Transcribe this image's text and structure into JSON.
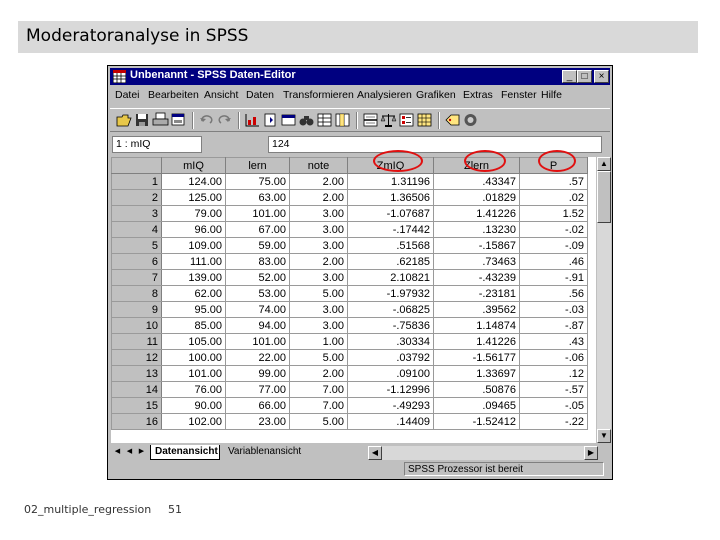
{
  "slide": {
    "title": "Moderatoranalyse in SPSS",
    "footer": "02_multiple_regression",
    "page_number": "51"
  },
  "window": {
    "title": "Unbenannt - SPSS Daten-Editor",
    "buttons": {
      "minimize": "_",
      "maximize": "□",
      "close": "×"
    }
  },
  "menu": [
    "Datei",
    "Bearbeiten",
    "Ansicht",
    "Daten",
    "Transformieren",
    "Analysieren",
    "Grafiken",
    "Extras",
    "Fenster",
    "Hilfe"
  ],
  "toolbar": {
    "icons": [
      "open-icon",
      "save-icon",
      "print-icon",
      "dialog-recall-icon",
      "undo-icon",
      "redo-icon",
      "goto-chart-icon",
      "goto-case-icon",
      "variables-icon",
      "find-icon",
      "insert-case-icon",
      "insert-variable-icon",
      "split-file-icon",
      "weight-cases-icon",
      "select-cases-icon",
      "value-labels-icon",
      "use-sets-icon"
    ]
  },
  "cell_editor": {
    "reference": "1 : mIQ",
    "value": "124"
  },
  "grid": {
    "columns": [
      "mIQ",
      "lern",
      "note",
      "ZmIQ",
      "Zlern",
      "P"
    ],
    "rows": [
      {
        "n": "1",
        "cells": [
          "124.00",
          "75.00",
          "2.00",
          "1.31196",
          ".43347",
          ".57"
        ]
      },
      {
        "n": "2",
        "cells": [
          "125.00",
          "63.00",
          "2.00",
          "1.36506",
          ".01829",
          ".02"
        ]
      },
      {
        "n": "3",
        "cells": [
          "79.00",
          "101.00",
          "3.00",
          "-1.07687",
          "1.41226",
          "1.52"
        ]
      },
      {
        "n": "4",
        "cells": [
          "96.00",
          "67.00",
          "3.00",
          "-.17442",
          ".13230",
          "-.02"
        ]
      },
      {
        "n": "5",
        "cells": [
          "109.00",
          "59.00",
          "3.00",
          ".51568",
          "-.15867",
          "-.09"
        ]
      },
      {
        "n": "6",
        "cells": [
          "111.00",
          "83.00",
          "2.00",
          ".62185",
          ".73463",
          ".46"
        ]
      },
      {
        "n": "7",
        "cells": [
          "139.00",
          "52.00",
          "3.00",
          "2.10821",
          "-.43239",
          "-.91"
        ]
      },
      {
        "n": "8",
        "cells": [
          "62.00",
          "53.00",
          "5.00",
          "-1.97932",
          "-.23181",
          ".56"
        ]
      },
      {
        "n": "9",
        "cells": [
          "95.00",
          "74.00",
          "3.00",
          "-.06825",
          ".39562",
          "-.03"
        ]
      },
      {
        "n": "10",
        "cells": [
          "85.00",
          "94.00",
          "3.00",
          "-.75836",
          "1.14874",
          "-.87"
        ]
      },
      {
        "n": "11",
        "cells": [
          "105.00",
          "101.00",
          "1.00",
          ".30334",
          "1.41226",
          ".43"
        ]
      },
      {
        "n": "12",
        "cells": [
          "100.00",
          "22.00",
          "5.00",
          ".03792",
          "-1.56177",
          "-.06"
        ]
      },
      {
        "n": "13",
        "cells": [
          "101.00",
          "99.00",
          "2.00",
          ".09100",
          "1.33697",
          ".12"
        ]
      },
      {
        "n": "14",
        "cells": [
          "76.00",
          "77.00",
          "7.00",
          "-1.12996",
          ".50876",
          "-.57"
        ]
      },
      {
        "n": "15",
        "cells": [
          "90.00",
          "66.00",
          "7.00",
          "-.49293",
          ".09465",
          "-.05"
        ]
      },
      {
        "n": "16",
        "cells": [
          "102.00",
          "23.00",
          "5.00",
          ".14409",
          "-1.52412",
          "-.22"
        ]
      }
    ]
  },
  "tabs": {
    "data_view": "Datenansicht",
    "variable_view": "Variablenansicht"
  },
  "status": "SPSS Prozessor ist bereit",
  "colors": {
    "titlebar": "#000080",
    "highlight": "#e01010",
    "chrome": "#c0c0c0"
  }
}
